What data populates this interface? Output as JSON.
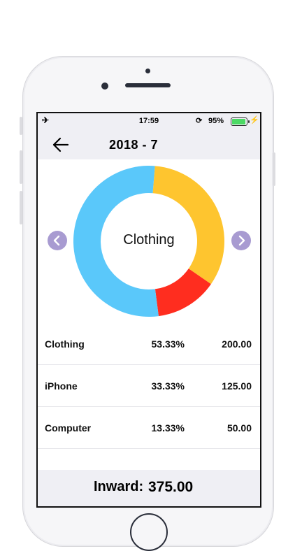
{
  "status_bar": {
    "time": "17:59",
    "battery": "95%",
    "battery_level": 0.95
  },
  "nav": {
    "title": "2018 - 7"
  },
  "chart_data": {
    "type": "pie",
    "center_label": "Clothing",
    "categories": [
      "Clothing",
      "iPhone",
      "Computer"
    ],
    "values": [
      200.0,
      125.0,
      50.0
    ],
    "colors": [
      "#5ac8fa",
      "#fec52f",
      "#ff2d1f"
    ]
  },
  "rows": [
    {
      "name": "Clothing",
      "percent": "53.33%",
      "amount": "200.00"
    },
    {
      "name": "iPhone",
      "percent": "33.33%",
      "amount": "125.00"
    },
    {
      "name": "Computer",
      "percent": "13.33%",
      "amount": "50.00"
    }
  ],
  "footer": {
    "label": "Inward:",
    "value": "375.00"
  }
}
